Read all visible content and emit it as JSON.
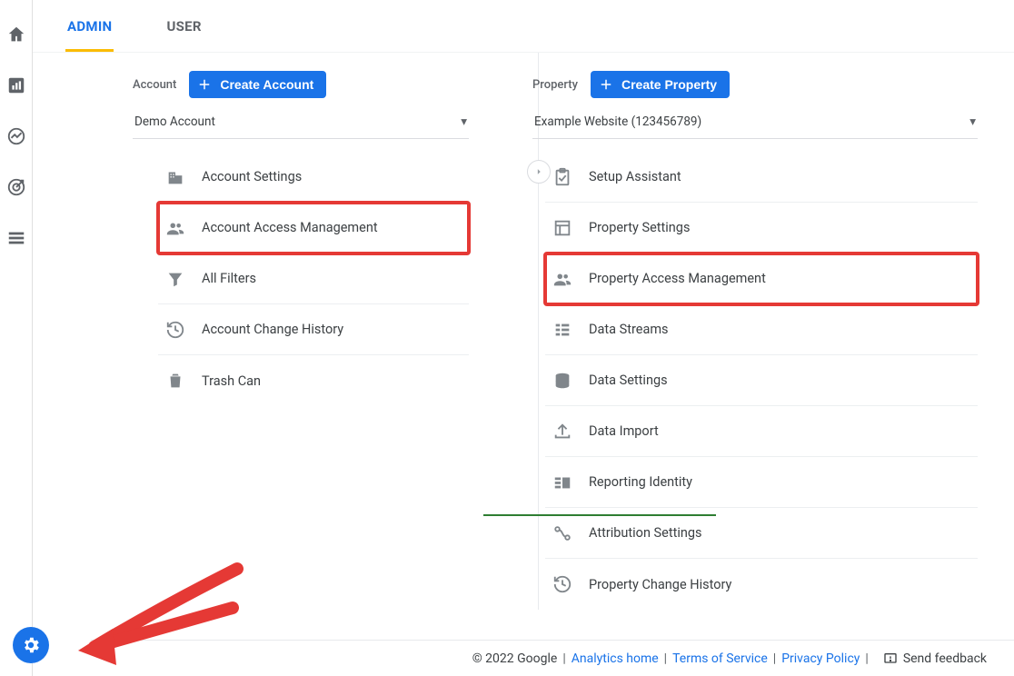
{
  "tabs": {
    "admin": "ADMIN",
    "user": "USER"
  },
  "account": {
    "label": "Account",
    "create_btn": "Create Account",
    "selected": "Demo Account",
    "items": [
      {
        "label": "Account Settings"
      },
      {
        "label": "Account Access Management"
      },
      {
        "label": "All Filters"
      },
      {
        "label": "Account Change History"
      },
      {
        "label": "Trash Can"
      }
    ]
  },
  "property": {
    "label": "Property",
    "create_btn": "Create Property",
    "selected": "Example Website (123456789)",
    "items": [
      {
        "label": "Setup Assistant"
      },
      {
        "label": "Property Settings"
      },
      {
        "label": "Property Access Management"
      },
      {
        "label": "Data Streams"
      },
      {
        "label": "Data Settings"
      },
      {
        "label": "Data Import"
      },
      {
        "label": "Reporting Identity"
      },
      {
        "label": "Attribution Settings"
      },
      {
        "label": "Property Change History"
      }
    ]
  },
  "footer": {
    "copyright": "© 2022 Google",
    "home": "Analytics home",
    "tos": "Terms of Service",
    "privacy": "Privacy Policy",
    "feedback": "Send feedback"
  }
}
